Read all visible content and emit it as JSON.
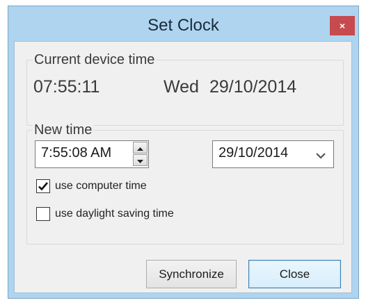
{
  "window": {
    "title": "Set Clock",
    "close_glyph": "×"
  },
  "current_group": {
    "legend": "Current device time",
    "time": "07:55:11",
    "weekday": "Wed",
    "date": "29/10/2014"
  },
  "new_group": {
    "legend": "New time",
    "time_value": "7:55:08 AM",
    "date_value": "29/10/2014",
    "use_computer_time": {
      "label": "use computer time",
      "checked": true
    },
    "use_daylight_saving": {
      "label": "use daylight saving time",
      "checked": false
    }
  },
  "buttons": {
    "synchronize": "Synchronize",
    "close": "Close"
  },
  "colors": {
    "frame": "#aed4f0",
    "close_button": "#c74a4f",
    "dialog_bg": "#f0f0f0"
  }
}
